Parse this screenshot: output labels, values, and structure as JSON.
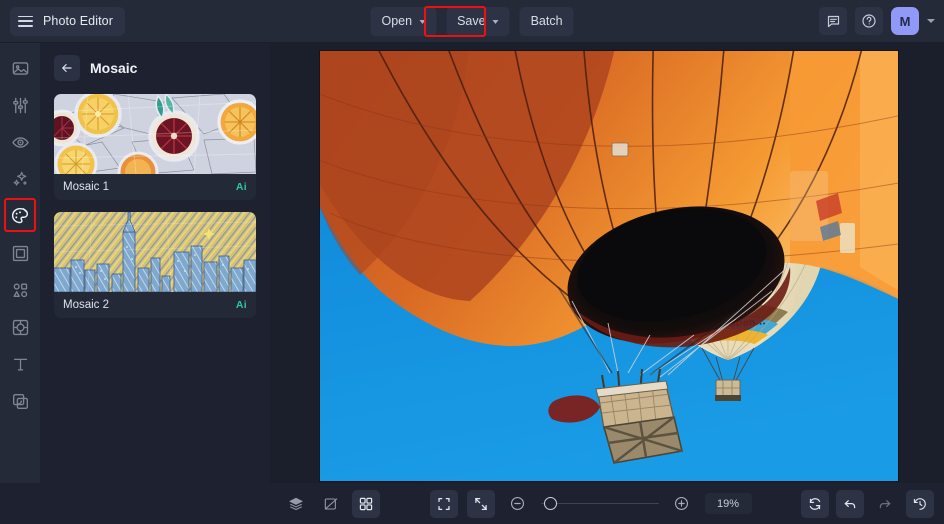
{
  "app": {
    "name": "Photo Editor",
    "menu_icon": "hamburger-icon"
  },
  "topbar": {
    "open_label": "Open",
    "save_label": "Save",
    "batch_label": "Batch",
    "feedback_icon": "comment-icon",
    "help_icon": "question-circle-icon",
    "avatar_initial": "M",
    "accent_highlight": "#ee1111",
    "avatar_color": "#9099f7"
  },
  "sidebar": {
    "items": [
      {
        "name": "image",
        "icon": "image-icon",
        "active": false
      },
      {
        "name": "adjust",
        "icon": "sliders-icon",
        "active": false
      },
      {
        "name": "retouch",
        "icon": "eye-icon",
        "active": false
      },
      {
        "name": "effects",
        "icon": "sparkles-icon",
        "active": false
      },
      {
        "name": "styles",
        "icon": "palette-icon",
        "active": true
      },
      {
        "name": "frames",
        "icon": "frame-icon",
        "active": false
      },
      {
        "name": "shapes",
        "icon": "shapes-icon",
        "active": false
      },
      {
        "name": "focus",
        "icon": "focus-icon",
        "active": false
      },
      {
        "name": "text",
        "icon": "text-icon",
        "active": false
      },
      {
        "name": "layers",
        "icon": "copy-layers-icon",
        "active": false
      }
    ]
  },
  "panel": {
    "back_icon": "arrow-left-icon",
    "title": "Mosaic",
    "presets": [
      {
        "label": "Mosaic 1",
        "badge": "Ai",
        "thumb": "citrus-mosaic-thumbnail"
      },
      {
        "label": "Mosaic 2",
        "badge": "Ai",
        "thumb": "city-skyline-mosaic-thumbnail"
      }
    ],
    "badge_color": "#2fc4a8"
  },
  "canvas": {
    "image_alt": "hot-air-balloons-against-blue-sky",
    "sky_color": "#1390dd"
  },
  "bottombar": {
    "layers_icon": "layers-icon",
    "compare_icon": "compare-split-icon",
    "grid_icon": "grid-view-icon",
    "fit_icon": "fit-to-screen-icon",
    "actual_icon": "collapse-arrows-icon",
    "zoom_out_icon": "minus-circle-icon",
    "zoom_in_icon": "plus-circle-icon",
    "zoom_value": "19%",
    "reset_icon": "reset-rotate-icon",
    "undo_icon": "undo-arrow-icon",
    "redo_icon": "redo-arrow-icon",
    "history_icon": "history-clock-icon"
  }
}
